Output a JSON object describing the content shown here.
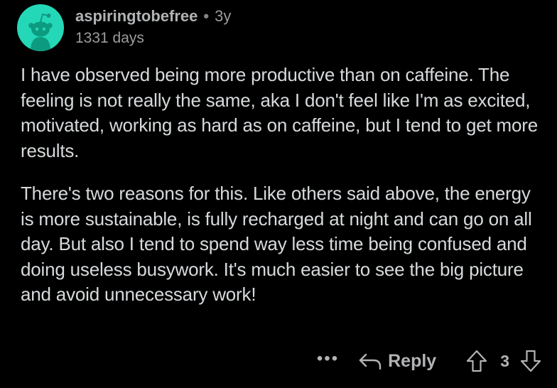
{
  "comment": {
    "author": "aspiringtobefree",
    "separator": "•",
    "age": "3y",
    "days": "1331 days",
    "avatar_icon": "snoo-avatar-icon",
    "avatar_color": "#24d8b7",
    "paragraphs": [
      "I have observed being more productive than on caffeine. The feeling is not really the same, aka I don't feel like I'm as excited, motivated, working as hard as on caffeine, but I tend to get more results.",
      "There's two reasons for this. Like others said above, the energy is more sustainable, is fully recharged at night and can go on all day. But also I tend to spend way less time being confused and doing useless busywork. It's much easier to see the big picture and avoid unnecessary work!"
    ]
  },
  "actions": {
    "more_label": "•••",
    "reply_label": "Reply",
    "vote_count": "3",
    "reply_icon": "reply-arrow-icon",
    "upvote_icon": "upvote-arrow-icon",
    "downvote_icon": "downvote-arrow-icon"
  },
  "colors": {
    "background": "#000000",
    "text": "#d7dadc",
    "muted": "#b1b3b5"
  }
}
